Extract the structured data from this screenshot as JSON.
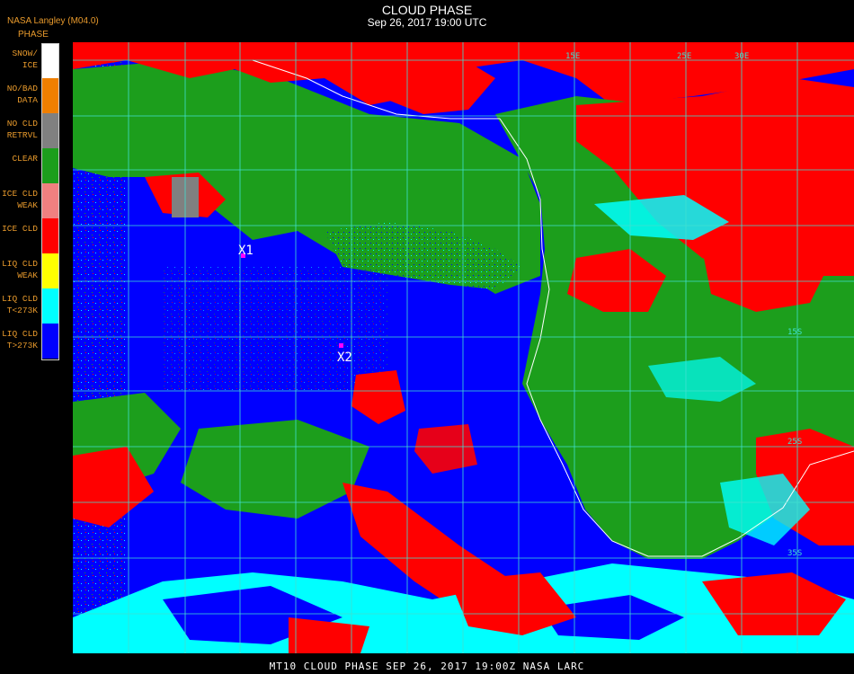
{
  "header": {
    "organization": "NASA Langley (M04.0)",
    "title": "CLOUD PHASE",
    "subtitle": "Sep 26, 2017 19:00 UTC"
  },
  "legend": {
    "title": "PHASE",
    "items": [
      {
        "label": "SNOW/\nICE",
        "color": "#ffffff"
      },
      {
        "label": "NO/BAD\nDATA",
        "color": "#f07f00"
      },
      {
        "label": "NO CLD\nRETRVL",
        "color": "#808080"
      },
      {
        "label": "CLEAR",
        "color": "#1c9e1c"
      },
      {
        "label": "ICE CLD\nWEAK",
        "color": "#f08080"
      },
      {
        "label": "ICE CLD",
        "color": "#ff0000"
      },
      {
        "label": "LIQ CLD\nWEAK",
        "color": "#ffff00"
      },
      {
        "label": "LIQ CLD\nT<273K",
        "color": "#00ffff"
      },
      {
        "label": "LIQ CLD\nT>273K",
        "color": "#0000ff"
      }
    ]
  },
  "map": {
    "markers": [
      {
        "label": "X1",
        "marker_color": "#ff00ff"
      },
      {
        "label": "X2",
        "marker_color": "#ff00ff"
      }
    ],
    "grid_labels": [
      "15E",
      "25E",
      "30E",
      "15S",
      "25S",
      "35S"
    ],
    "colors": {
      "ocean_liquid": "#0000ff",
      "clear": "#1c9e1c",
      "ice": "#ff0000",
      "liquid_cold": "#00ffff",
      "grid": "#40e0d0",
      "coast": "#ffffff"
    }
  },
  "footer": {
    "text": "MT10  CLOUD PHASE   SEP 26, 2017 19:00Z   NASA LARC"
  }
}
